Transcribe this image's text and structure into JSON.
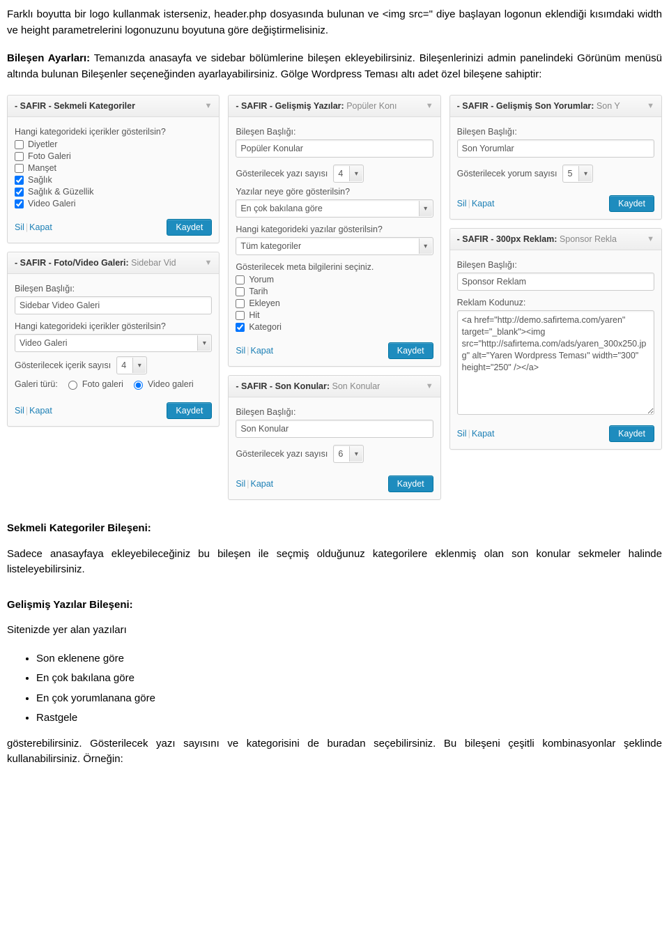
{
  "intro": {
    "p1": "Farklı boyutta bir logo kullanmak isterseniz, header.php dosyasında bulunan ve <img src=\" diye başlayan logonun eklendiği kısımdaki width ve height parametrelerini logonuzunu boyutuna göre değiştirmelisiniz.",
    "p2_label": "Bileşen Ayarları:",
    "p2_text": " Temanızda anasayfa ve sidebar bölümlerine bileşen ekleyebilirsiniz. Bileşenlerinizi admin panelindeki Görünüm menüsü altında bulunan Bileşenler seçeneğinden ayarlayabilirsiniz. Gölge Wordpress Teması altı adet özel bileşene sahiptir:"
  },
  "actions": {
    "delete": "Sil",
    "close": "Kapat",
    "save": "Kaydet"
  },
  "labels": {
    "component_title": "Bileşen Başlığı:",
    "show_content_cat": "Hangi kategorideki içerikler gösterilsin?",
    "show_post_cat": "Hangi kategorideki yazılar gösterilsin?",
    "meta_select": "Gösterilecek meta bilgilerini seçiniz.",
    "posts_how": "Yazılar neye göre gösterilsin?",
    "post_count": "Gösterilecek yazı sayısı",
    "comment_count": "Gösterilecek yorum sayısı",
    "content_count": "Gösterilecek içerik sayısı",
    "gallery_type": "Galeri türü:",
    "ad_code": "Reklam Kodunuz:"
  },
  "widgets": {
    "tabcats": {
      "title_pre": "- SAFIR - Sekmeli Kategoriler",
      "cats": [
        {
          "label": "Diyetler",
          "checked": false
        },
        {
          "label": "Foto Galeri",
          "checked": false
        },
        {
          "label": "Manşet",
          "checked": false
        },
        {
          "label": "Sağlık",
          "checked": true
        },
        {
          "label": "Sağlık & Güzellik",
          "checked": true
        },
        {
          "label": "Video Galeri",
          "checked": true
        }
      ]
    },
    "gallery": {
      "title_pre": "- SAFIR - Foto/Video Galeri:",
      "title_suf": " Sidebar Vid",
      "value": "Sidebar Video Galeri",
      "cat_sel": "Video Galeri",
      "count": "4",
      "radio_foto": "Foto galeri",
      "radio_video": "Video galeri"
    },
    "advposts": {
      "title_pre": "- SAFIR - Gelişmiş Yazılar:",
      "title_suf": " Popüler Konı",
      "value": "Popüler Konular",
      "count": "4",
      "order_sel": "En çok bakılana göre",
      "cat_sel": "Tüm kategoriler",
      "meta": [
        {
          "label": "Yorum",
          "checked": false
        },
        {
          "label": "Tarih",
          "checked": false
        },
        {
          "label": "Ekleyen",
          "checked": false
        },
        {
          "label": "Hit",
          "checked": false
        },
        {
          "label": "Kategori",
          "checked": true
        }
      ]
    },
    "lastposts": {
      "title_pre": "- SAFIR - Son Konular:",
      "title_suf": " Son Konular",
      "value": "Son Konular",
      "count": "6"
    },
    "comments": {
      "title_pre": "- SAFIR - Gelişmiş Son Yorumlar:",
      "title_suf": " Son Y",
      "value": "Son Yorumlar",
      "count": "5"
    },
    "ad": {
      "title_pre": "- SAFIR - 300px Reklam:",
      "title_suf": " Sponsor Rekla",
      "value": "Sponsor Reklam",
      "code": "<a href=\"http://demo.safirtema.com/yaren\" target=\"_blank\"><img src=\"http://safirtema.com/ads/yaren_300x250.jpg\" alt=\"Yaren Wordpress Teması\" width=\"300\" height=\"250\" /></a>"
    }
  },
  "after": {
    "h1": "Sekmeli Kategoriler Bileşeni:",
    "p1": "Sadece anasayfaya ekleyebileceğiniz bu bileşen ile seçmiş olduğunuz kategorilere eklenmiş olan son konular sekmeler halinde listeleyebilirsiniz.",
    "h2": "Gelişmiş Yazılar Bileşeni:",
    "p2": "Sitenizde yer alan yazıları",
    "bullets": [
      "Son eklenene göre",
      "En çok bakılana göre",
      "En çok yorumlanana göre",
      "Rastgele"
    ],
    "p3": "gösterebilirsiniz. Gösterilecek yazı sayısını ve kategorisini de buradan seçebilirsiniz. Bu bileşeni çeşitli kombinasyonlar şeklinde kullanabilirsiniz. Örneğin:"
  }
}
